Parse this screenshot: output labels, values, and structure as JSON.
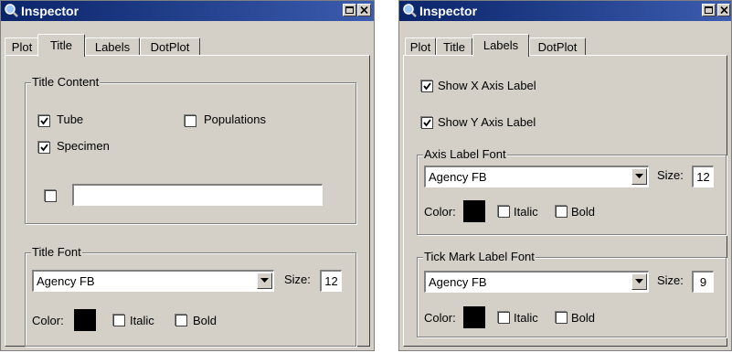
{
  "colors": {
    "titlebar": "#0a246a",
    "face": "#d4d0c8",
    "swatch": "#000000"
  },
  "left": {
    "title": "Inspector",
    "tabs": [
      {
        "label": "Plot",
        "active": false
      },
      {
        "label": "Title",
        "active": true
      },
      {
        "label": "Labels",
        "active": false
      },
      {
        "label": "DotPlot",
        "active": false
      }
    ],
    "content_group": {
      "legend": "Title Content",
      "tube": {
        "label": "Tube",
        "checked": true
      },
      "populations": {
        "label": "Populations",
        "checked": false
      },
      "specimen": {
        "label": "Specimen",
        "checked": true
      },
      "custom": {
        "checked": false,
        "value": ""
      }
    },
    "font_group": {
      "legend": "Title Font",
      "font": "Agency FB",
      "size_label": "Size:",
      "size": "12",
      "color_label": "Color:",
      "italic": {
        "label": "Italic",
        "checked": false
      },
      "bold": {
        "label": "Bold",
        "checked": false
      }
    }
  },
  "right": {
    "title": "Inspector",
    "tabs": [
      {
        "label": "Plot",
        "active": false
      },
      {
        "label": "Title",
        "active": false
      },
      {
        "label": "Labels",
        "active": true
      },
      {
        "label": "DotPlot",
        "active": false
      }
    ],
    "show_x": {
      "label": "Show X Axis Label",
      "checked": true
    },
    "show_y": {
      "label": "Show Y Axis Label",
      "checked": true
    },
    "axis_group": {
      "legend": "Axis Label Font",
      "font": "Agency FB",
      "size_label": "Size:",
      "size": "12",
      "color_label": "Color:",
      "italic": {
        "label": "Italic",
        "checked": false
      },
      "bold": {
        "label": "Bold",
        "checked": false
      }
    },
    "tick_group": {
      "legend": "Tick Mark Label Font",
      "font": "Agency FB",
      "size_label": "Size:",
      "size": "9",
      "color_label": "Color:",
      "italic": {
        "label": "Italic",
        "checked": false
      },
      "bold": {
        "label": "Bold",
        "checked": false
      }
    }
  },
  "icons": {
    "window": "magnifier-icon",
    "maximize": "maximize-icon",
    "close": "close-icon",
    "dropdown": "dropdown-arrow-icon",
    "check": "checkmark-icon"
  }
}
